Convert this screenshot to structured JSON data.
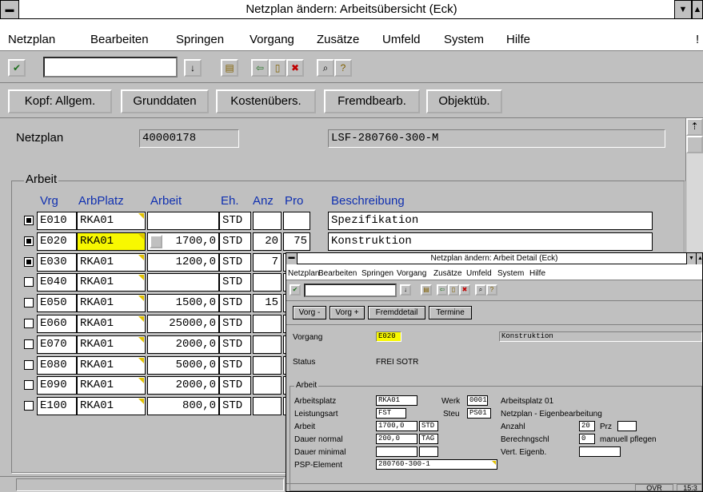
{
  "window": {
    "title": "Netzplan ändern: Arbeitsübersicht (Eck)"
  },
  "menu": [
    {
      "label": "Netzplan"
    },
    {
      "label": "Bearbeiten"
    },
    {
      "label": "Springen"
    },
    {
      "label": "Vorgang"
    },
    {
      "label": "Zusätze"
    },
    {
      "label": "Umfeld"
    },
    {
      "label": "System"
    },
    {
      "label": "Hilfe"
    }
  ],
  "toolbar": {
    "command_value": ""
  },
  "buttons": [
    {
      "label": "Kopf: Allgem."
    },
    {
      "label": "Grunddaten"
    },
    {
      "label": "Kostenübers."
    },
    {
      "label": "Fremdbearb."
    },
    {
      "label": "Objektüb."
    }
  ],
  "header": {
    "netzplan_label": "Netzplan",
    "netzplan_value": "40000178",
    "description": "LSF-280760-300-M"
  },
  "arbeit": {
    "group_title": "Arbeit",
    "columns": [
      "Vrg",
      "ArbPlatz",
      "Arbeit",
      "Eh.",
      "Anz",
      "Pro",
      "Beschreibung"
    ],
    "rows": [
      {
        "checked": true,
        "vrg": "E010",
        "arbplatz": "RKA01",
        "arbeit": "",
        "eh": "STD",
        "anz": "",
        "pro": "",
        "beschreibung": "Spezifikation"
      },
      {
        "checked": true,
        "vrg": "E020",
        "arbplatz": "RKA01",
        "arbeit": "1700,0",
        "eh": "STD",
        "anz": "20",
        "pro": "75",
        "beschreibung": "Konstruktion"
      },
      {
        "checked": true,
        "vrg": "E030",
        "arbplatz": "RKA01",
        "arbeit": "1200,0",
        "eh": "STD",
        "anz": "7",
        "pro": "",
        "beschreibung": ""
      },
      {
        "checked": false,
        "vrg": "E040",
        "arbplatz": "RKA01",
        "arbeit": "",
        "eh": "STD",
        "anz": "",
        "pro": "",
        "beschreibung": ""
      },
      {
        "checked": false,
        "vrg": "E050",
        "arbplatz": "RKA01",
        "arbeit": "1500,0",
        "eh": "STD",
        "anz": "15",
        "pro": "",
        "beschreibung": ""
      },
      {
        "checked": false,
        "vrg": "E060",
        "arbplatz": "RKA01",
        "arbeit": "25000,0",
        "eh": "STD",
        "anz": "",
        "pro": "",
        "beschreibung": ""
      },
      {
        "checked": false,
        "vrg": "E070",
        "arbplatz": "RKA01",
        "arbeit": "2000,0",
        "eh": "STD",
        "anz": "",
        "pro": "",
        "beschreibung": ""
      },
      {
        "checked": false,
        "vrg": "E080",
        "arbplatz": "RKA01",
        "arbeit": "5000,0",
        "eh": "STD",
        "anz": "",
        "pro": "",
        "beschreibung": ""
      },
      {
        "checked": false,
        "vrg": "E090",
        "arbplatz": "RKA01",
        "arbeit": "2000,0",
        "eh": "STD",
        "anz": "",
        "pro": "",
        "beschreibung": ""
      },
      {
        "checked": false,
        "vrg": "E100",
        "arbplatz": "RKA01",
        "arbeit": "800,0",
        "eh": "STD",
        "anz": "",
        "pro": "",
        "beschreibung": ""
      }
    ]
  },
  "status": {
    "mode": "OVR",
    "time": "15:3"
  },
  "detail": {
    "title": "Netzplan ändern: Arbeit Detail (Eck)",
    "menu": [
      "Netzplan",
      "Bearbeiten",
      "Springen",
      "Vorgang",
      "Zusätze",
      "Umfeld",
      "System",
      "Hilfe"
    ],
    "buttons": [
      "Vorg -",
      "Vorg +",
      "Fremddetail",
      "Termine"
    ],
    "vorgang_label": "Vorgang",
    "vorgang_value": "E020",
    "vorgang_desc": "Konstruktion",
    "status_label": "Status",
    "status_value": "FREI SOTR",
    "group_title": "Arbeit",
    "arbeitsplatz_label": "Arbeitsplatz",
    "arbeitsplatz_value": "RKA01",
    "werk_label": "Werk",
    "werk_value": "0001",
    "arbeitsplatz_text": "Arbeitsplatz 01",
    "leistungsart_label": "Leistungsart",
    "leistungsart_value": "FST",
    "steu_label": "Steu",
    "steu_value": "PS01",
    "steu_text": "Netzplan - Eigenbearbeitung",
    "arbeit_label": "Arbeit",
    "arbeit_value": "1700,0",
    "arbeit_unit": "STD",
    "anzahl_label": "Anzahl",
    "anzahl_value": "20",
    "prz_label": "Prz",
    "prz_value": "",
    "dauer_normal_label": "Dauer normal",
    "dauer_normal_value": "200,0",
    "dauer_unit": "TAG",
    "berechnung_label": "Berechngschl",
    "berechnung_value": "0",
    "berechnung_text": "manuell pflegen",
    "dauer_minimal_label": "Dauer minimal",
    "dauer_minimal_value": "",
    "vert_label": "Vert. Eigenb.",
    "vert_value": "",
    "psp_label": "PSP-Element",
    "psp_value": "280760-300-1"
  }
}
